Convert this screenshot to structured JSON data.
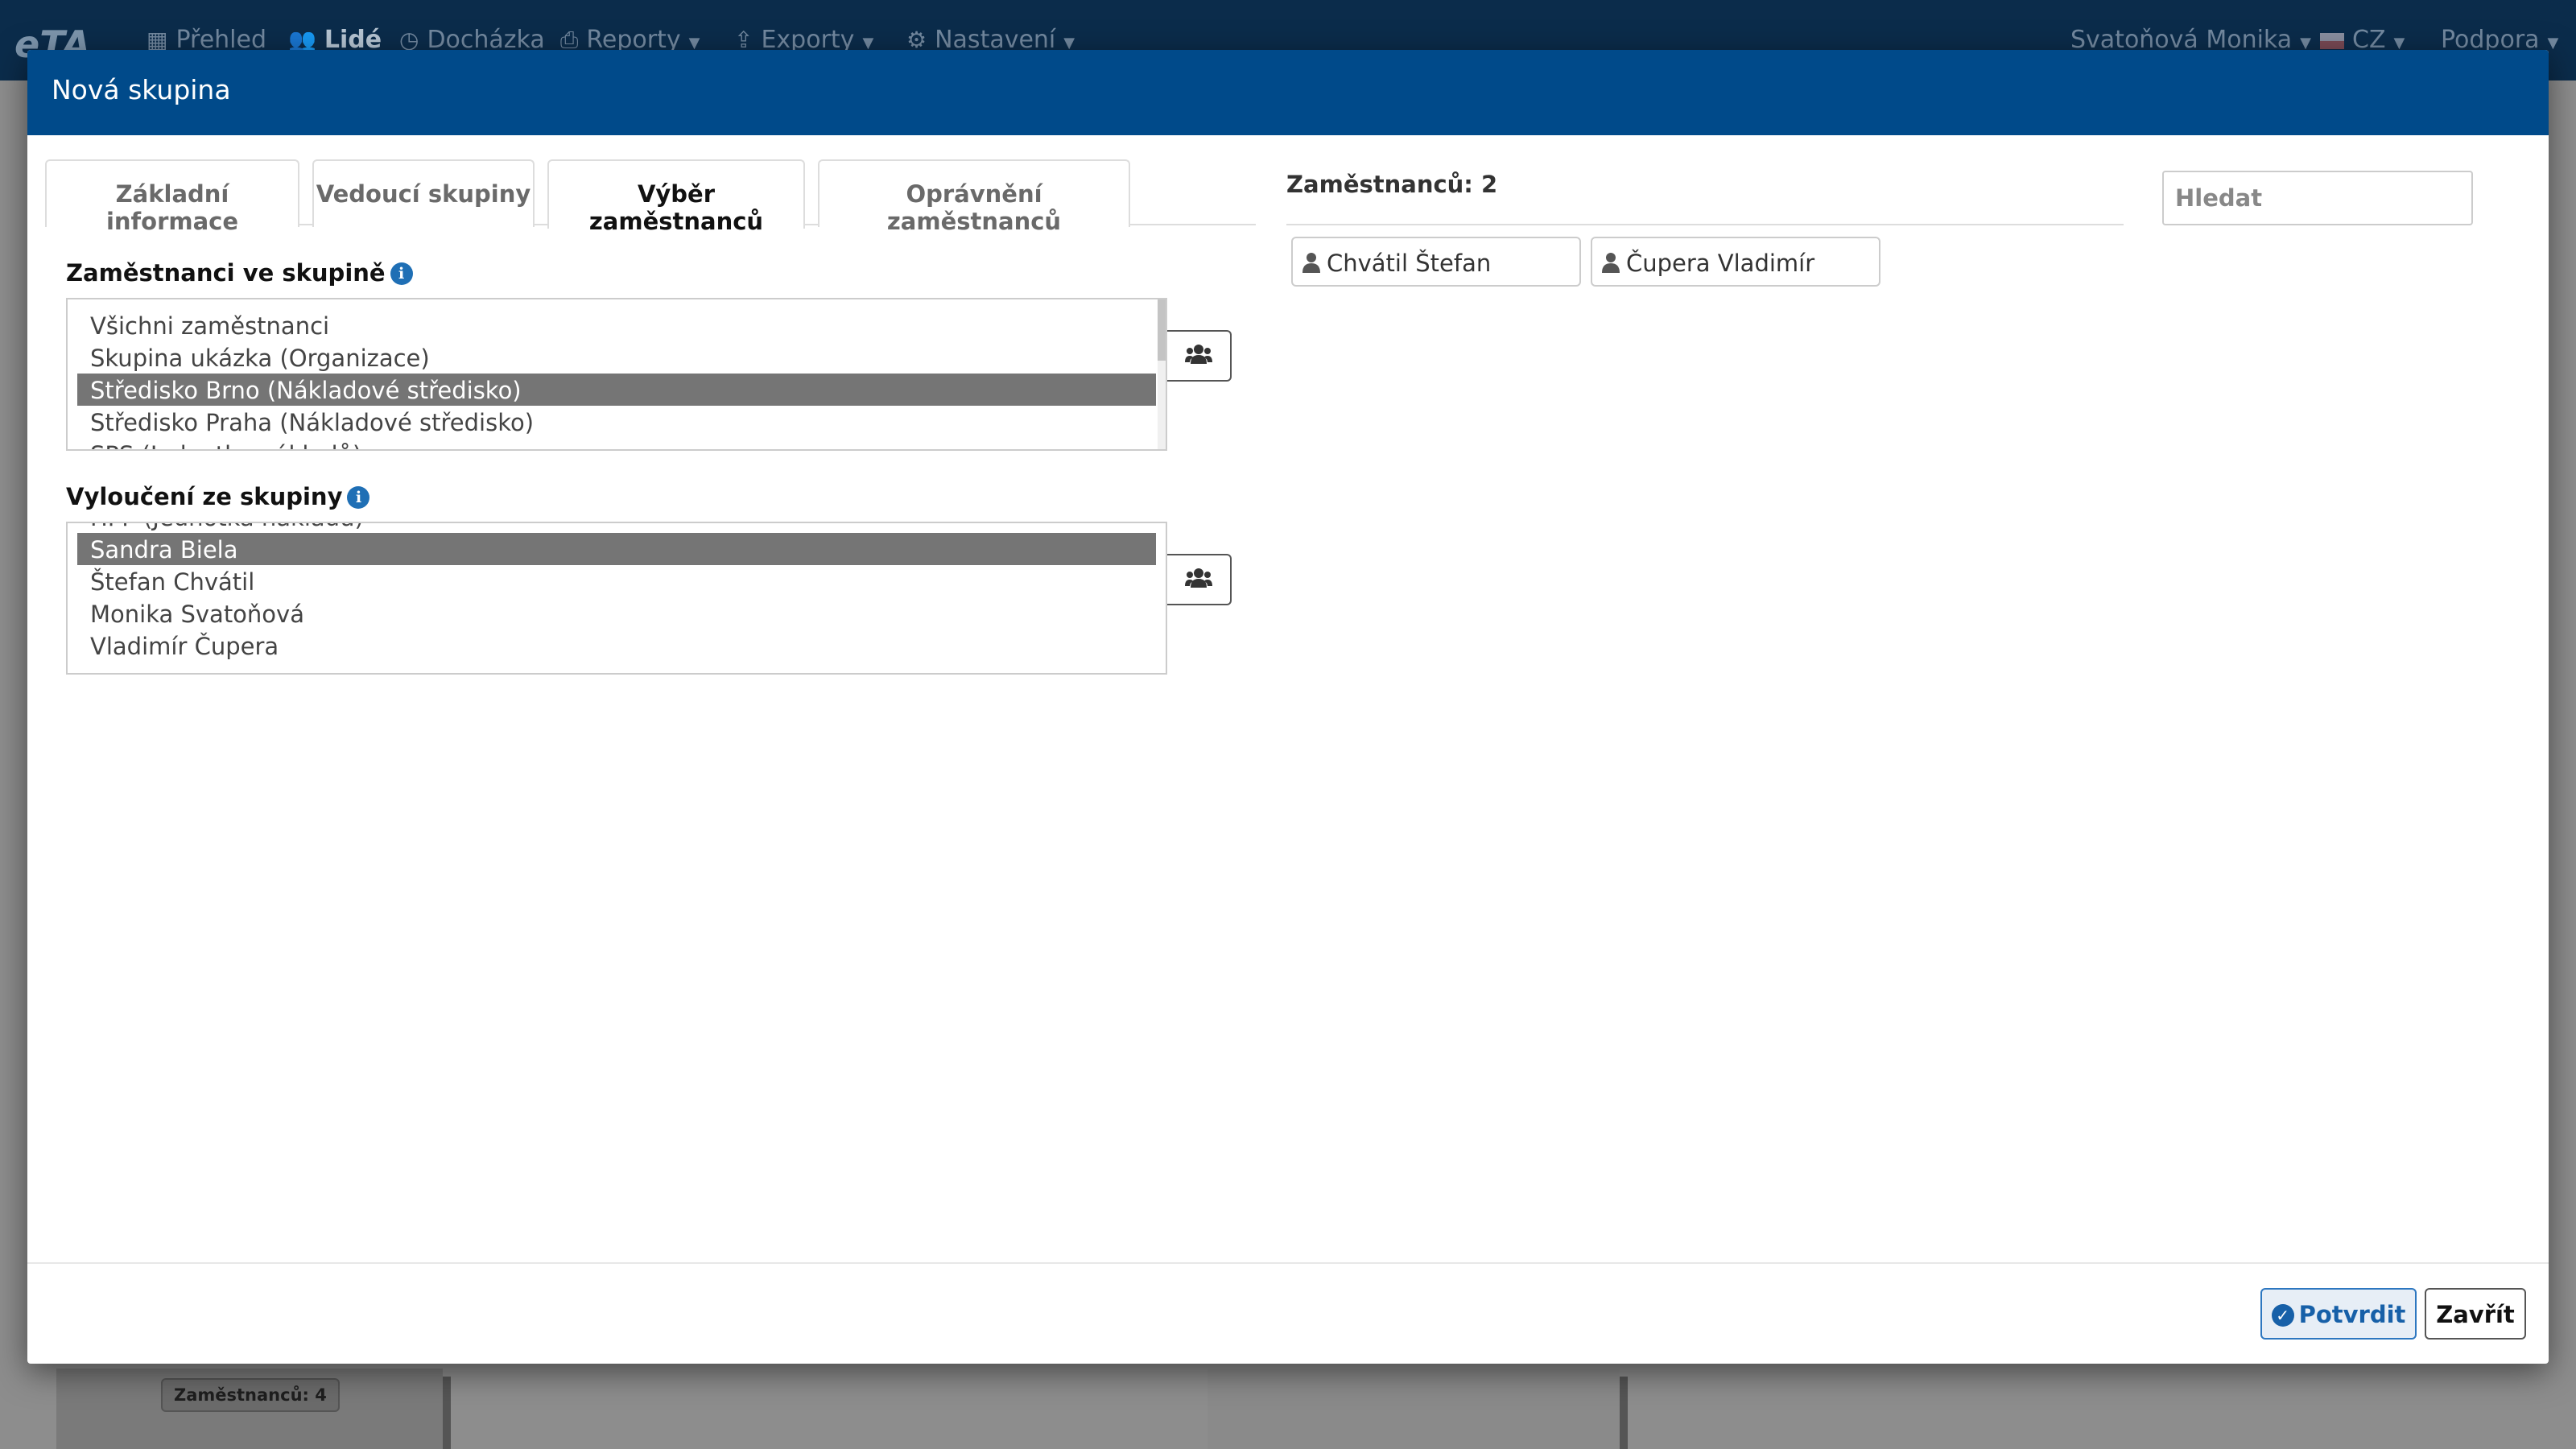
{
  "app": {
    "logo": "eTA",
    "nav": [
      {
        "label": "Přehled",
        "icon": "grid-icon",
        "active": false,
        "caret": false
      },
      {
        "label": "Lidé",
        "icon": "users-icon",
        "active": true,
        "caret": false
      },
      {
        "label": "Docházka",
        "icon": "clock-icon",
        "active": false,
        "caret": false
      },
      {
        "label": "Reporty",
        "icon": "print-icon",
        "active": false,
        "caret": true
      },
      {
        "label": "Exporty",
        "icon": "export-icon",
        "active": false,
        "caret": true
      },
      {
        "label": "Nastavení",
        "icon": "gear-icon",
        "active": false,
        "caret": true
      }
    ],
    "user_menu": "Svatoňová Monika",
    "language": "CZ",
    "support": "Podpora",
    "background_badge": "Zaměstnanců: 4"
  },
  "modal": {
    "title": "Nová skupina",
    "tabs": [
      {
        "label": "Základní informace",
        "active": false
      },
      {
        "label": "Vedoucí skupiny",
        "active": false
      },
      {
        "label": "Výběr zaměstnanců",
        "active": true
      },
      {
        "label": "Oprávnění zaměstnanců",
        "active": false
      }
    ],
    "included": {
      "label": "Zaměstnanci ve skupině",
      "options": [
        {
          "text": "Všichni zaměstnanci",
          "selected": false
        },
        {
          "text": "Skupina ukázka (Organizace)",
          "selected": false
        },
        {
          "text": "Středisko Brno (Nákladové středisko)",
          "selected": true
        },
        {
          "text": "Středisko Praha (Nákladové středisko)",
          "selected": false
        },
        {
          "text": "SPS (Jednotka nákladů)",
          "selected": false
        }
      ]
    },
    "excluded": {
      "label": "Vyloučení ze skupiny",
      "options": [
        {
          "text": "HPP (Jednotka nákladů)",
          "selected": false
        },
        {
          "text": "Sandra Biela",
          "selected": true
        },
        {
          "text": "Štefan Chvátil",
          "selected": false
        },
        {
          "text": "Monika Svatoňová",
          "selected": false
        },
        {
          "text": "Vladimír Čupera",
          "selected": false
        }
      ]
    },
    "employee_count": "Zaměstnanců: 2",
    "search_placeholder": "Hledat",
    "selected_employees": [
      "Chvátil Štefan",
      "Čupera Vladimír"
    ],
    "confirm_label": "Potvrdit",
    "close_label": "Zavřít"
  }
}
